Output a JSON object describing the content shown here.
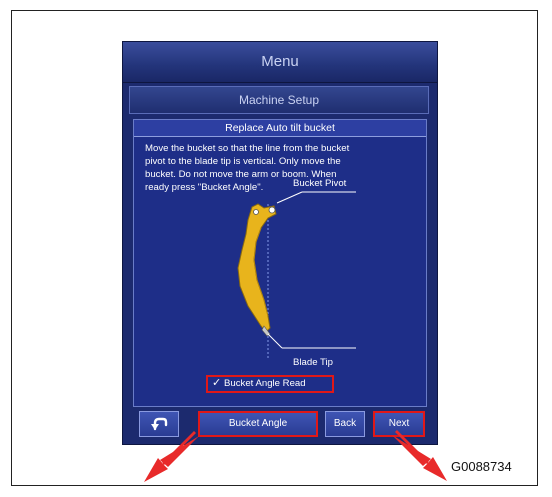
{
  "menu_title": "Menu",
  "section_title": "Machine Setup",
  "panel": {
    "title": "Replace Auto tilt bucket",
    "instructions": [
      "Move the bucket so that the line from the bucket",
      "pivot to the blade tip is vertical. Only move the",
      "bucket. Do not move the arm or boom. When",
      "ready press \"Bucket Angle\"."
    ],
    "diagram": {
      "pivot_label": "Bucket Pivot",
      "tip_label": "Blade Tip"
    },
    "checkbox": {
      "label": "Bucket Angle Read",
      "checked": true
    }
  },
  "buttons": {
    "back_icon": "undo-arrow-icon",
    "bucket_angle": "Bucket Angle",
    "back": "Back",
    "next": "Next"
  },
  "figure_id": "G0088734",
  "colors": {
    "screen_bg": "#1c2a6e",
    "panel_bg": "#1e2e88",
    "highlight": "#e01818",
    "bucket": "#e8b41c"
  }
}
